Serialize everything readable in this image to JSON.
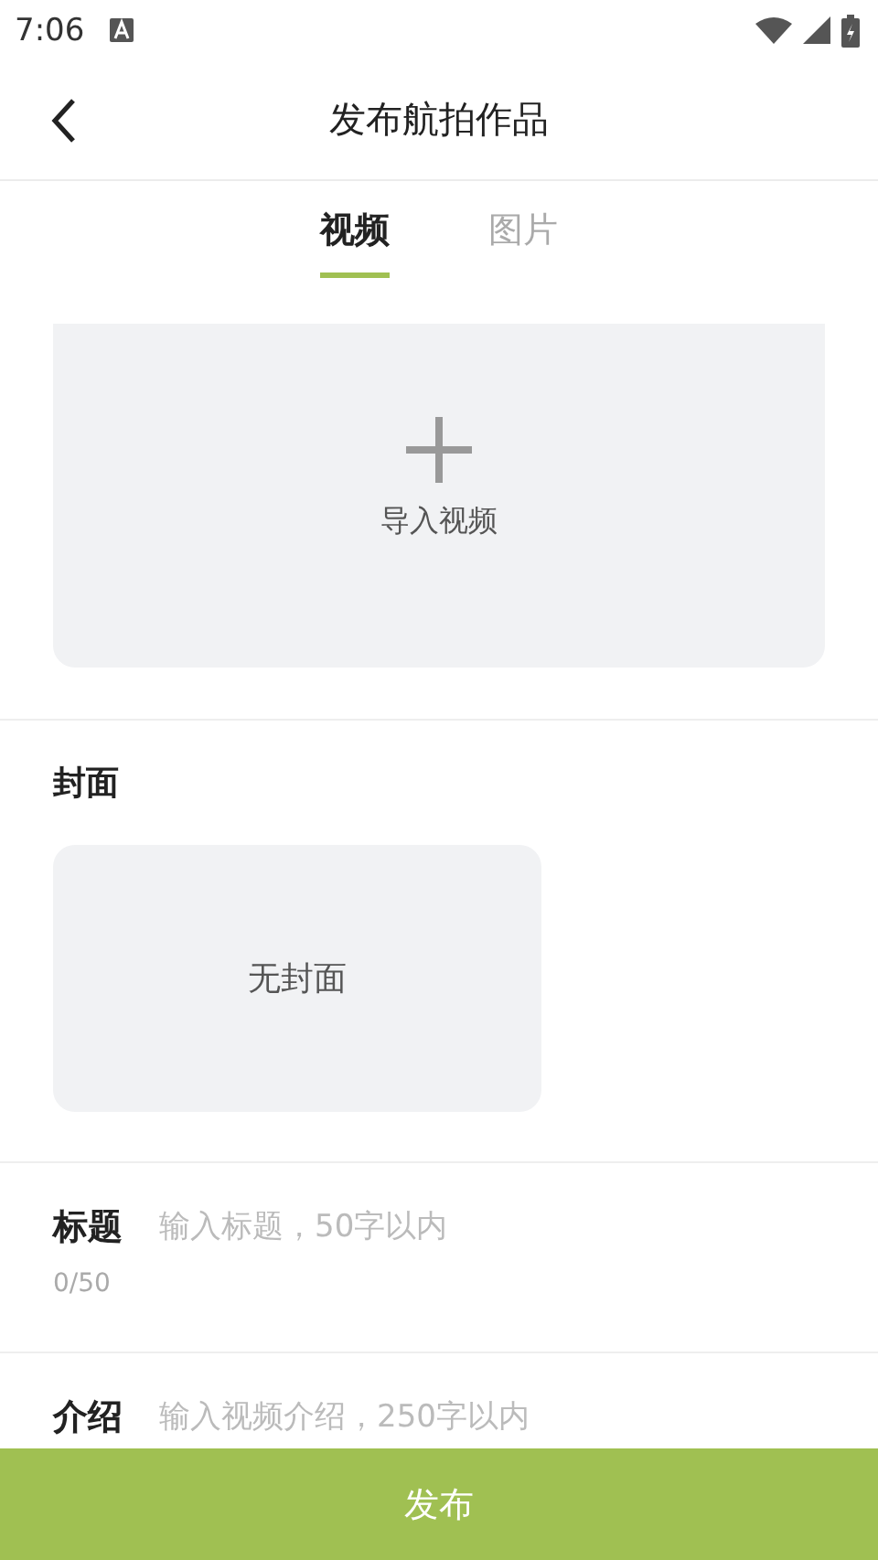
{
  "status_bar": {
    "time": "7:06"
  },
  "header": {
    "title": "发布航拍作品"
  },
  "tabs": [
    {
      "label": "视频",
      "selected": true
    },
    {
      "label": "图片",
      "selected": false
    }
  ],
  "upload": {
    "label": "导入视频"
  },
  "cover": {
    "heading": "封面",
    "empty_text": "无封面"
  },
  "fields": [
    {
      "label": "标题",
      "placeholder": "输入标题，50字以内",
      "counter": "0/50"
    },
    {
      "label": "介绍",
      "placeholder": "输入视频介绍，250字以内"
    }
  ],
  "submit_button": "发布"
}
